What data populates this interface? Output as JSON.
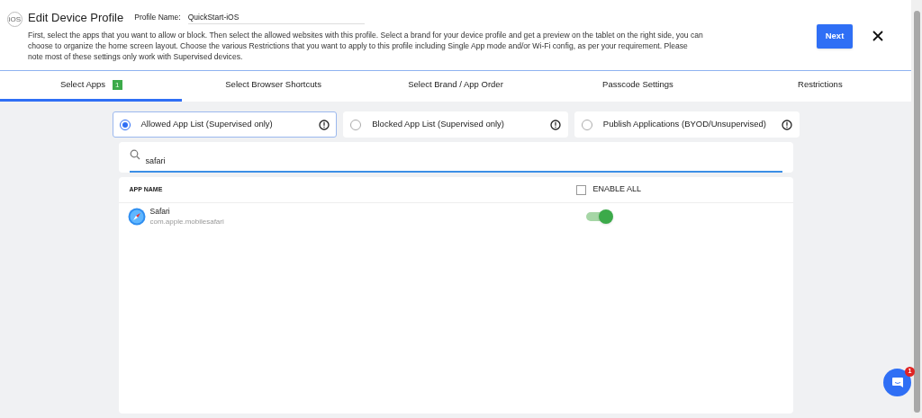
{
  "header": {
    "platform_badge": "iOS",
    "title": "Edit Device Profile",
    "profile_label": "Profile Name:",
    "profile_name": "QuickStart-iOS",
    "description": "First, select the apps that you want to allow or block. Then select the allowed websites with this profile. Select a brand for your device profile and get a preview on the tablet on the right side, you can choose to organize the home screen layout. Choose the various Restrictions that you want to apply to this profile including Single App mode and/or Wi-Fi config, as per your requirement. Please note most of these settings only work with Supervised devices.",
    "next_button": "Next"
  },
  "tabs": [
    {
      "label": "Select Apps",
      "badge": "1",
      "selected": true
    },
    {
      "label": "Select Browser Shortcuts",
      "selected": false
    },
    {
      "label": "Select Brand / App Order",
      "selected": false
    },
    {
      "label": "Passcode Settings",
      "selected": false
    },
    {
      "label": "Restrictions",
      "selected": false
    }
  ],
  "list_modes": [
    {
      "label": "Allowed App List (Supervised only)",
      "selected": true
    },
    {
      "label": "Blocked App List (Supervised only)",
      "selected": false
    },
    {
      "label": "Publish Applications (BYOD/Unsupervised)",
      "selected": false
    }
  ],
  "search": {
    "value": "safari"
  },
  "table": {
    "column_1": "APP NAME",
    "enable_all": {
      "label": "ENABLE ALL",
      "checked": false
    },
    "rows": [
      {
        "name": "Safari",
        "bundle_id": "com.apple.mobilesafari",
        "on": true
      }
    ]
  },
  "chat": {
    "badge": "1"
  }
}
